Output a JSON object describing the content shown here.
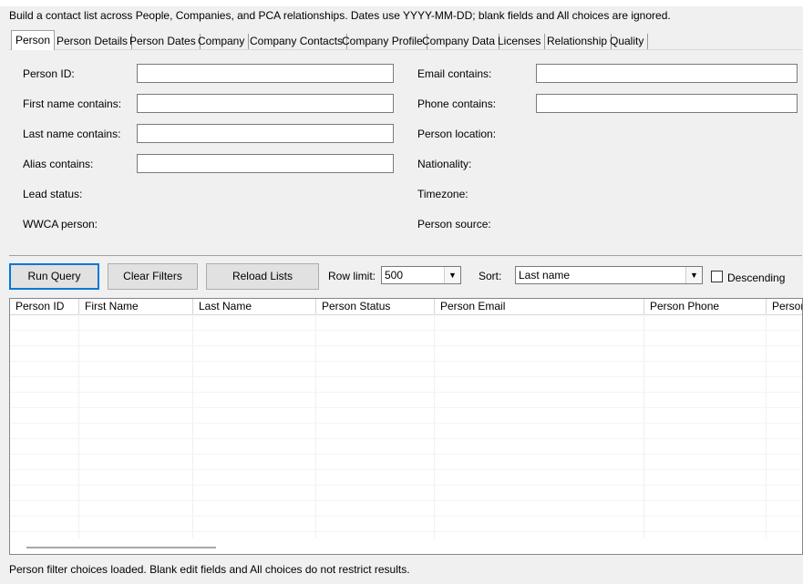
{
  "description": "Build a contact list across People, Companies, and PCA relationships. Dates use YYYY-MM-DD; blank fields and All choices are ignored.",
  "tabs": [
    "Person",
    "Person Details",
    "Person Dates",
    "Company",
    "Company Contacts",
    "Company Profile",
    "Company Data",
    "Licenses",
    "Relationship",
    "Quality"
  ],
  "active_tab": "Person",
  "filters": {
    "person_id": "Person ID:",
    "first_name": "First name contains:",
    "last_name": "Last name contains:",
    "alias": "Alias contains:",
    "lead_status": "Lead status:",
    "wwca": "WWCA person:",
    "email": "Email contains:",
    "phone": "Phone contains:",
    "location": "Person location:",
    "nationality": "Nationality:",
    "timezone": "Timezone:",
    "source": "Person source:"
  },
  "toolbar": {
    "run": "Run Query",
    "clear": "Clear Filters",
    "reload": "Reload Lists",
    "row_limit_label": "Row limit:",
    "row_limit_value": "500",
    "sort_label": "Sort:",
    "sort_value": "Last name",
    "descending_label": "Descending",
    "descending_checked": false
  },
  "columns": [
    "Person ID",
    "First Name",
    "Last Name",
    "Person Status",
    "Person Email",
    "Person Phone",
    "Person"
  ],
  "status": "Person filter choices loaded. Blank edit fields and All choices do not restrict results."
}
